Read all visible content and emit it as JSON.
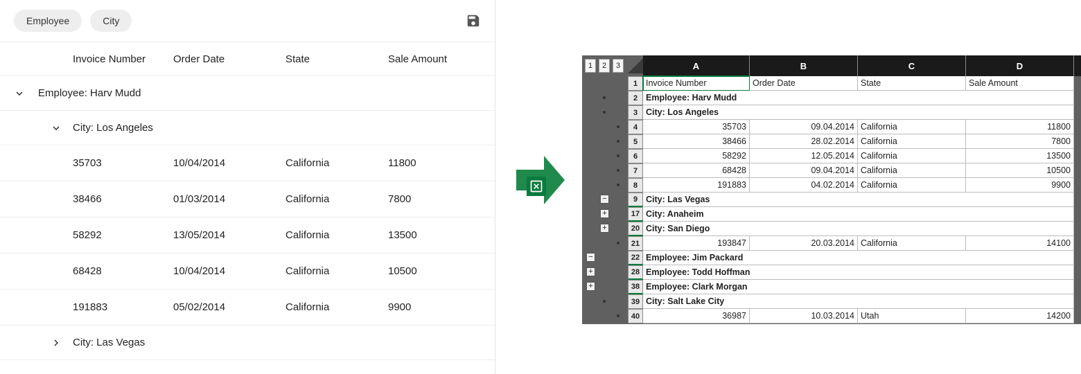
{
  "chips": {
    "employee": "Employee",
    "city": "City"
  },
  "grid": {
    "headers": {
      "invoice": "Invoice Number",
      "order_date": "Order Date",
      "state": "State",
      "sale_amount": "Sale Amount"
    },
    "group_employee": {
      "label": "Employee:",
      "value": "Harv Mudd"
    },
    "group_city_la": {
      "label": "City:",
      "value": "Los Angeles"
    },
    "group_city_vegas": {
      "label": "City:",
      "value": "Las Vegas"
    },
    "rows": [
      {
        "invoice": "35703",
        "date": "10/04/2014",
        "state": "California",
        "amount": "11800"
      },
      {
        "invoice": "38466",
        "date": "01/03/2014",
        "state": "California",
        "amount": "7800"
      },
      {
        "invoice": "58292",
        "date": "13/05/2014",
        "state": "California",
        "amount": "13500"
      },
      {
        "invoice": "68428",
        "date": "10/04/2014",
        "state": "California",
        "amount": "10500"
      },
      {
        "invoice": "191883",
        "date": "05/02/2014",
        "state": "California",
        "amount": "9900"
      }
    ]
  },
  "excel": {
    "outline_levels": [
      "1",
      "2",
      "3"
    ],
    "cols": [
      "A",
      "B",
      "C",
      "D"
    ],
    "rows": [
      {
        "n": "1",
        "type": "header",
        "a": "Invoice Number",
        "b": "Order Date",
        "c": "State",
        "d": "Sale Amount"
      },
      {
        "n": "2",
        "type": "group",
        "text": "Employee: Harv Mudd"
      },
      {
        "n": "3",
        "type": "group",
        "text": "City: Los Angeles"
      },
      {
        "n": "4",
        "type": "data",
        "a": "35703",
        "b": "09.04.2014",
        "c": "California",
        "d": "11800"
      },
      {
        "n": "5",
        "type": "data",
        "a": "38466",
        "b": "28.02.2014",
        "c": "California",
        "d": "7800"
      },
      {
        "n": "6",
        "type": "data",
        "a": "58292",
        "b": "12.05.2014",
        "c": "California",
        "d": "13500"
      },
      {
        "n": "7",
        "type": "data",
        "a": "68428",
        "b": "09.04.2014",
        "c": "California",
        "d": "10500"
      },
      {
        "n": "8",
        "type": "data",
        "a": "191883",
        "b": "04.02.2014",
        "c": "California",
        "d": "9900"
      },
      {
        "n": "9",
        "type": "group",
        "text": "City: Las Vegas",
        "pm": "-"
      },
      {
        "n": "17",
        "type": "group",
        "text": "City: Anaheim",
        "pm": "+"
      },
      {
        "n": "20",
        "type": "group",
        "text": "City: San Diego",
        "pm": "+"
      },
      {
        "n": "21",
        "type": "data",
        "a": "193847",
        "b": "20.03.2014",
        "c": "California",
        "d": "14100"
      },
      {
        "n": "22",
        "type": "group",
        "text": "Employee: Jim Packard",
        "pm": "-",
        "col": 0
      },
      {
        "n": "28",
        "type": "group",
        "text": "Employee: Todd Hoffman",
        "pm": "+",
        "col": 0
      },
      {
        "n": "38",
        "type": "group",
        "text": "Employee: Clark Morgan",
        "pm": "+",
        "col": 0
      },
      {
        "n": "39",
        "type": "group",
        "text": "City: Salt Lake City"
      },
      {
        "n": "40",
        "type": "data",
        "a": "36987",
        "b": "10.03.2014",
        "c": "Utah",
        "d": "14200"
      }
    ]
  }
}
